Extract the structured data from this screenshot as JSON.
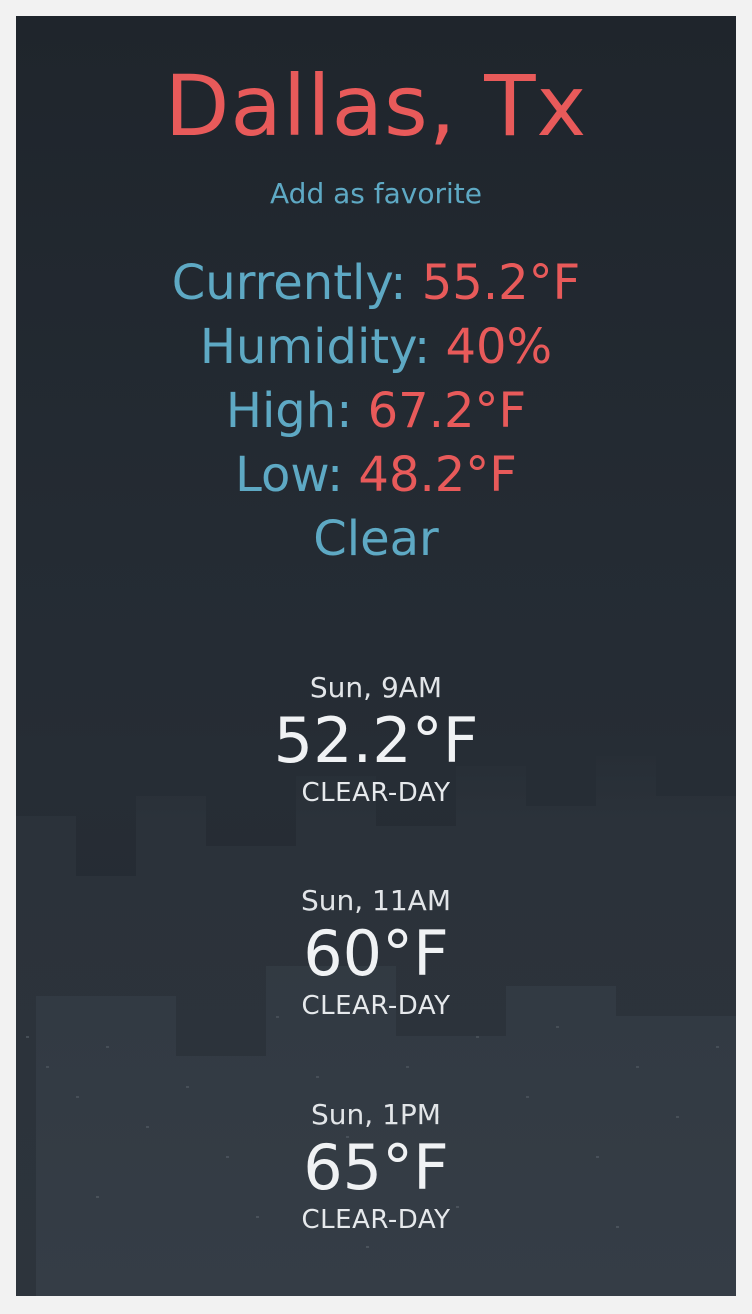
{
  "location": {
    "title": "Dallas, Tx",
    "favorite_link": "Add as favorite"
  },
  "current": {
    "currently_label": "Currently:",
    "currently_value": "55.2°F",
    "humidity_label": "Humidity:",
    "humidity_value": "40%",
    "high_label": "High:",
    "high_value": "67.2°F",
    "low_label": "Low:",
    "low_value": "48.2°F",
    "condition": "Clear"
  },
  "hourly": [
    {
      "time": "Sun, 9AM",
      "temp": "52.2°F",
      "summary": "CLEAR-DAY"
    },
    {
      "time": "Sun, 11AM",
      "temp": "60°F",
      "summary": "CLEAR-DAY"
    },
    {
      "time": "Sun, 1PM",
      "temp": "65°F",
      "summary": "CLEAR-DAY"
    }
  ],
  "colors": {
    "accent_red": "#e85a5a",
    "accent_blue": "#5ea9c4",
    "background": "#242b33"
  }
}
